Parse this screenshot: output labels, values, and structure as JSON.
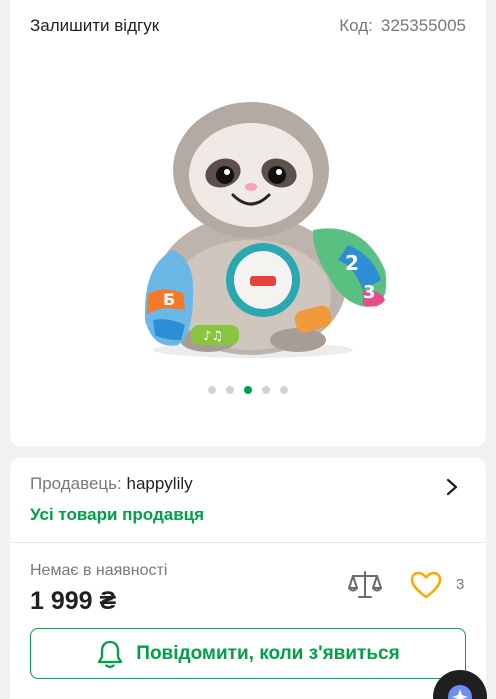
{
  "header": {
    "review_link": "Залишити відгук",
    "code_label": "Код:",
    "code_value": "325355005"
  },
  "gallery": {
    "image_alt": "Fisher-Price smiling sloth toy",
    "dots_count": 5,
    "active_dot": 3
  },
  "seller": {
    "label": "Продавець:",
    "name": "happylily",
    "all_goods_link": "Усі товари продавця"
  },
  "purchase": {
    "stock_status": "Немає в наявності",
    "price": "1 999 ₴",
    "wishlist_count": "3",
    "notify_button": "Повідомити, коли з'явиться"
  },
  "icons": {
    "seller": "chevron-right-icon",
    "compare": "compare-scales-icon",
    "wishlist": "heart-icon",
    "notify": "bell-icon",
    "assistant": "sparkle-icon"
  },
  "colors": {
    "accent": "#00a046",
    "heart": "#ffa900",
    "text": "#221f1f",
    "muted": "#797878"
  }
}
